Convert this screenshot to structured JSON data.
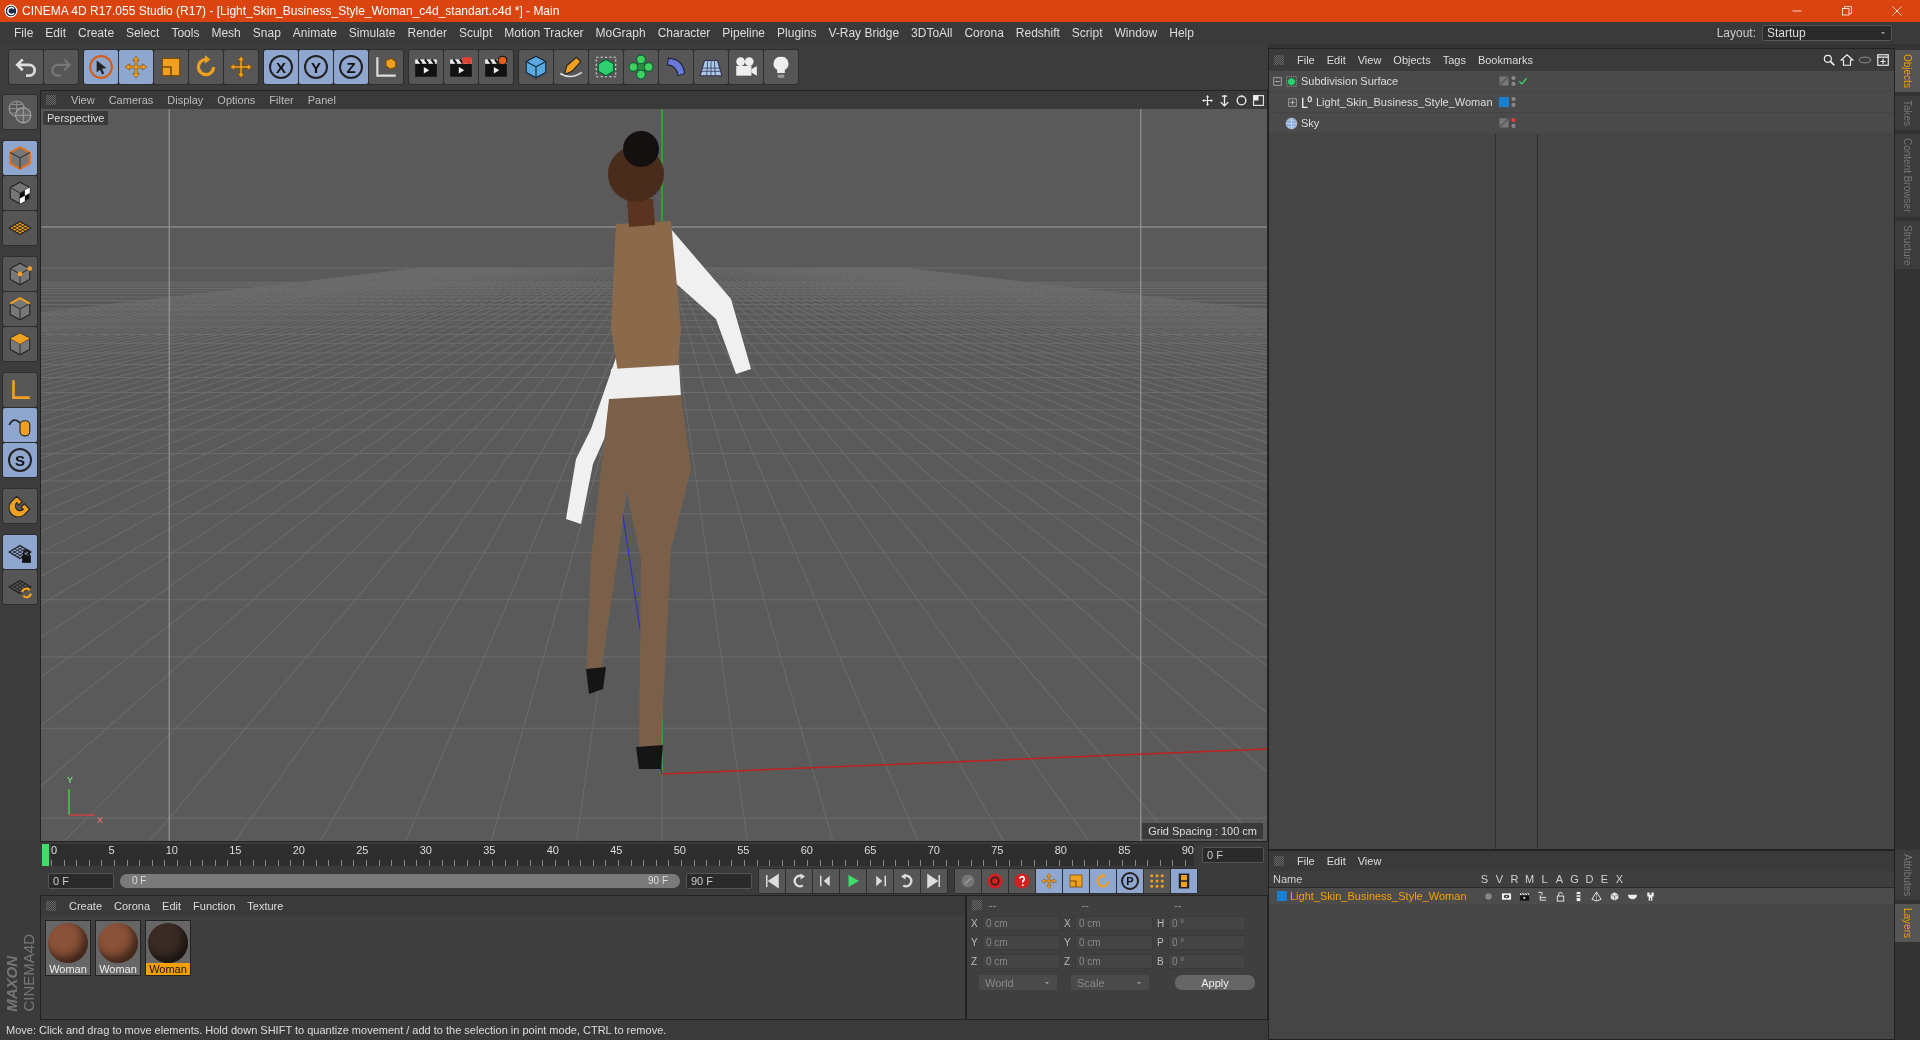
{
  "title_bar": {
    "title": "CINEMA 4D R17.055 Studio (R17) - [Light_Skin_Business_Style_Woman_c4d_standart.c4d *] - Main"
  },
  "menu_bar": {
    "items": [
      "File",
      "Edit",
      "Create",
      "Select",
      "Tools",
      "Mesh",
      "Snap",
      "Animate",
      "Simulate",
      "Render",
      "Sculpt",
      "Motion Tracker",
      "MoGraph",
      "Character",
      "Pipeline",
      "Plugins",
      "V-Ray Bridge",
      "3DToAll",
      "Corona",
      "Redshift",
      "Script",
      "Window",
      "Help"
    ],
    "layout_label": "Layout:",
    "layout_value": "Startup"
  },
  "toolbar": [
    {
      "items": [
        {
          "kind": "undo",
          "selected": false
        },
        {
          "kind": "redo",
          "selected": false
        }
      ]
    },
    {
      "items": [
        {
          "kind": "select",
          "selected": true
        },
        {
          "kind": "move",
          "selected": true
        },
        {
          "kind": "scale",
          "selected": false
        },
        {
          "kind": "rotate",
          "selected": false
        },
        {
          "kind": "transform",
          "selected": false
        }
      ]
    },
    {
      "items": [
        {
          "kind": "axis",
          "label": "X",
          "selected": true
        },
        {
          "kind": "axis",
          "label": "Y",
          "selected": true
        },
        {
          "kind": "axis",
          "label": "Z",
          "selected": true
        },
        {
          "kind": "coord",
          "selected": false
        }
      ]
    },
    {
      "items": [
        {
          "kind": "render_view",
          "selected": false
        },
        {
          "kind": "render_picture",
          "selected": false
        },
        {
          "kind": "render_settings",
          "selected": false
        }
      ]
    },
    {
      "items": [
        {
          "kind": "cube",
          "selected": false
        },
        {
          "kind": "pen",
          "selected": false
        },
        {
          "kind": "subdivision",
          "selected": false
        },
        {
          "kind": "cloner",
          "selected": false
        },
        {
          "kind": "bend",
          "selected": false
        },
        {
          "kind": "floor",
          "selected": false
        },
        {
          "kind": "camera",
          "selected": false
        },
        {
          "kind": "light",
          "selected": false
        }
      ]
    }
  ],
  "left_toolbar": [
    {
      "items": [
        {
          "kind": "scene",
          "selected": false
        }
      ]
    },
    {
      "items": [
        {
          "kind": "model",
          "selected": true
        },
        {
          "kind": "texture",
          "selected": false
        },
        {
          "kind": "workplane",
          "selected": false
        }
      ]
    },
    {
      "items": [
        {
          "kind": "points",
          "selected": false
        },
        {
          "kind": "edges",
          "selected": false
        },
        {
          "kind": "polygons",
          "selected": false
        }
      ]
    },
    {
      "items": [
        {
          "kind": "axis_mode",
          "selected": false
        },
        {
          "kind": "tweak",
          "selected": true
        },
        {
          "kind": "letter",
          "label": "S",
          "selected": true
        }
      ]
    },
    {
      "items": [
        {
          "kind": "magnet",
          "selected": false
        }
      ]
    },
    {
      "items": [
        {
          "kind": "grid_lock",
          "selected": true
        },
        {
          "kind": "grid_sync",
          "selected": false
        }
      ]
    }
  ],
  "viewport": {
    "menu": [
      "View",
      "Cameras",
      "Display",
      "Options",
      "Filter",
      "Panel"
    ],
    "camera": "Perspective",
    "grid_spacing": "Grid Spacing : 100 cm",
    "axis_labels": [
      "Y",
      "X"
    ]
  },
  "timeline": {
    "ticks": [
      "0",
      "5",
      "10",
      "15",
      "20",
      "25",
      "30",
      "35",
      "40",
      "45",
      "50",
      "55",
      "60",
      "65",
      "70",
      "75",
      "80",
      "85",
      "90"
    ],
    "current_frame": "0 F",
    "start": "0 F",
    "range": {
      "start": "0 F",
      "end": "90 F",
      "level": 1
    },
    "end": "90 F",
    "playback": [
      {
        "kind": "to_start"
      },
      {
        "kind": "prev_key"
      },
      {
        "kind": "prev_frame"
      },
      {
        "kind": "play"
      },
      {
        "kind": "next_frame"
      },
      {
        "kind": "next_key"
      },
      {
        "kind": "to_end"
      }
    ],
    "keying": [
      {
        "kind": "key_off",
        "selected": false
      },
      {
        "kind": "autokey",
        "selected": false
      },
      {
        "kind": "key_help",
        "selected": false
      },
      {
        "kind": "move",
        "selected": true
      },
      {
        "kind": "scale",
        "selected": true
      },
      {
        "kind": "rotate",
        "selected": true
      },
      {
        "kind": "letter",
        "label": "P",
        "selected": true
      },
      {
        "kind": "dots",
        "selected": false
      },
      {
        "kind": "film",
        "selected": true
      }
    ]
  },
  "logo": {
    "brand": "MAXON",
    "product": "CINEMA4D"
  },
  "materials": {
    "menu": [
      "Create",
      "Corona",
      "Edit",
      "Function",
      "Texture"
    ],
    "items": [
      {
        "name": "Woman",
        "selected": false,
        "color": "#8a5238"
      },
      {
        "name": "Woman",
        "selected": false,
        "color": "#8a5238"
      },
      {
        "name": "Woman",
        "selected": true,
        "color": "#3a2c24"
      }
    ]
  },
  "coordinates": {
    "headers": [
      "--",
      "--",
      "--"
    ],
    "columns": [
      [
        {
          "axis": "X",
          "value": "0 cm"
        },
        {
          "axis": "Y",
          "value": "0 cm"
        },
        {
          "axis": "Z",
          "value": "0 cm"
        }
      ],
      [
        {
          "axis": "X",
          "value": "0 cm"
        },
        {
          "axis": "Y",
          "value": "0 cm"
        },
        {
          "axis": "Z",
          "value": "0 cm"
        }
      ],
      [
        {
          "axis": "H",
          "value": "0 °"
        },
        {
          "axis": "P",
          "value": "0 °"
        },
        {
          "axis": "B",
          "value": "0 °"
        }
      ]
    ],
    "dropdowns": [
      "World",
      "Scale"
    ],
    "apply": "Apply"
  },
  "object_manager": {
    "menu": [
      "File",
      "Edit",
      "View",
      "Objects",
      "Tags",
      "Bookmarks"
    ],
    "objects": [
      {
        "name": "Subdivision Surface",
        "kind": "subdivision",
        "expanded": true,
        "editor_hidden": false,
        "checked": true,
        "children": [
          {
            "name": "Light_Skin_Business_Style_Woman",
            "kind": "null",
            "expanded": false,
            "color": "#1a7fd0",
            "editor_hidden": false,
            "checked": false
          }
        ]
      },
      {
        "name": "Sky",
        "kind": "sky",
        "editor_hidden": true,
        "checked": false
      }
    ]
  },
  "layers_manager": {
    "menu": [
      "File",
      "Edit",
      "View"
    ],
    "columns": [
      "Name",
      "S",
      "V",
      "R",
      "M",
      "L",
      "A",
      "G",
      "D",
      "E",
      "X"
    ],
    "layers": [
      {
        "name": "Light_Skin_Business_Style_Woman",
        "color": "#1a7fd0",
        "selected": true,
        "flags": [
          {
            "kind": "solo"
          },
          {
            "kind": "view"
          },
          {
            "kind": "render"
          },
          {
            "kind": "manager"
          },
          {
            "kind": "lock"
          },
          {
            "kind": "animation"
          },
          {
            "kind": "generators"
          },
          {
            "kind": "deformers"
          },
          {
            "kind": "expressions"
          },
          {
            "kind": "xref"
          }
        ]
      }
    ]
  },
  "side_tabs": {
    "top": [
      {
        "label": "Objects",
        "selected": true
      },
      {
        "label": "Takes",
        "selected": false
      },
      {
        "label": "Content Browser",
        "selected": false
      },
      {
        "label": "Structure",
        "selected": false
      }
    ],
    "bottom": [
      {
        "label": "Attributes",
        "selected": false
      },
      {
        "label": "Layers",
        "selected": true
      }
    ]
  },
  "status_bar": {
    "text": "Move: Click and drag to move elements. Hold down SHIFT to quantize movement / add to the selection in point mode, CTRL to remove."
  }
}
